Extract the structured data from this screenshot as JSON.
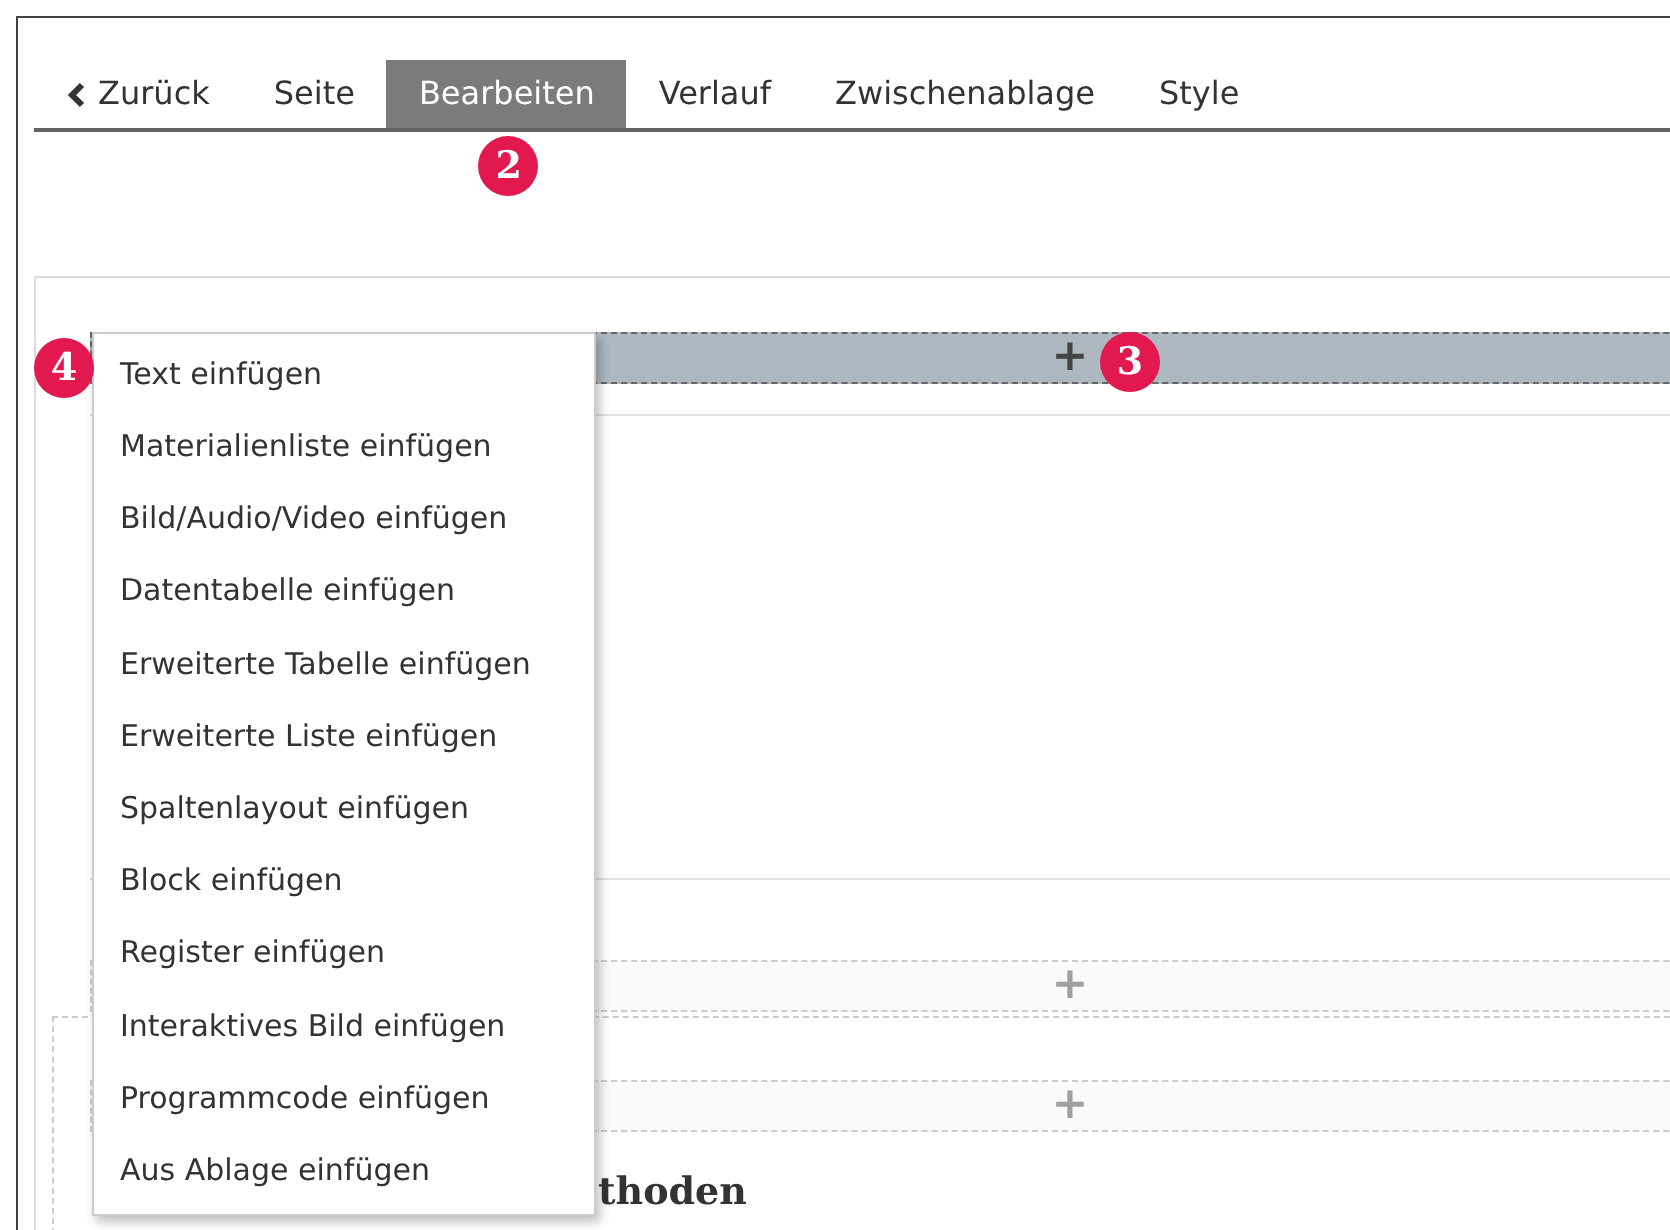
{
  "tabs": [
    {
      "label": "Zurück",
      "kind": "back",
      "selected": false
    },
    {
      "label": "Seite",
      "kind": "tab",
      "selected": false
    },
    {
      "label": "Bearbeiten",
      "kind": "tab",
      "selected": true,
      "callout": "2"
    },
    {
      "label": "Verlauf",
      "kind": "tab",
      "selected": false
    },
    {
      "label": "Zwischenablage",
      "kind": "tab",
      "selected": false
    },
    {
      "label": "Style",
      "kind": "tab",
      "selected": false
    }
  ],
  "add_bars": [
    {
      "label": "+",
      "active": true,
      "callout": "3"
    },
    {
      "label": "+",
      "active": false
    },
    {
      "label": "+",
      "active": false
    }
  ],
  "menu": {
    "callout": "4",
    "items": [
      "Text einfügen",
      "Materialienliste einfügen",
      "Bild/Audio/Video einfügen",
      "Datentabelle einfügen",
      "Erweiterte Tabelle einfügen",
      "Erweiterte Liste einfügen",
      "Spaltenlayout einfügen",
      "Block einfügen",
      "Register einfügen",
      "Interaktives Bild einfügen",
      "Programmcode einfügen",
      "Aus Ablage einfügen"
    ]
  },
  "heading": "thoden"
}
